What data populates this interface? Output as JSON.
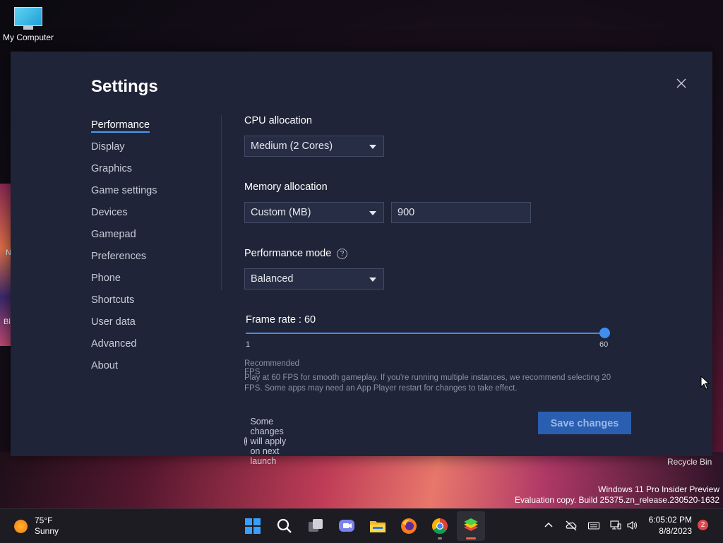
{
  "desktop": {
    "my_computer": "My Computer",
    "recycle_bin": "Recycle Bin",
    "edge_labels": [
      "N",
      "Bl"
    ],
    "watermark_line1": "Windows 11 Pro Insider Preview",
    "watermark_line2": "Evaluation copy. Build 25375.zn_release.230520-1632"
  },
  "settings": {
    "title": "Settings",
    "nav": [
      {
        "label": "Performance",
        "active": true
      },
      {
        "label": "Display"
      },
      {
        "label": "Graphics"
      },
      {
        "label": "Game settings"
      },
      {
        "label": "Devices"
      },
      {
        "label": "Gamepad"
      },
      {
        "label": "Preferences"
      },
      {
        "label": "Phone"
      },
      {
        "label": "Shortcuts"
      },
      {
        "label": "User data"
      },
      {
        "label": "Advanced"
      },
      {
        "label": "About"
      }
    ],
    "cpu": {
      "label": "CPU allocation",
      "value": "Medium (2 Cores)"
    },
    "memory": {
      "label": "Memory allocation",
      "mode": "Custom (MB)",
      "amount": "900"
    },
    "performance_mode": {
      "label": "Performance mode",
      "help": "?",
      "value": "Balanced"
    },
    "frame_rate": {
      "label": "Frame rate : 60",
      "min": "1",
      "max": "60",
      "value": 60
    },
    "recommended": {
      "title": "Recommended FPS",
      "body": "Play at 60 FPS for smooth gameplay. If you're running multiple instances, we recommend selecting 20 FPS. Some apps may need an App Player restart for changes to take effect."
    },
    "info_note": "Some changes will apply on next launch",
    "info_icon": "i",
    "save_label": "Save changes"
  },
  "taskbar": {
    "temperature": "75°F",
    "condition": "Sunny",
    "time": "6:05:02 PM",
    "date": "8/8/2023",
    "notifications": "2",
    "icons": [
      "start-icon",
      "search-icon",
      "task-view-icon",
      "teams-chat-icon",
      "file-explorer-icon",
      "firefox-icon",
      "chrome-icon",
      "bluestacks-icon"
    ]
  },
  "colors": {
    "accent": "#3d8ff0",
    "dialog_bg": "#1f2438",
    "save_button": "#2a5eb0"
  }
}
